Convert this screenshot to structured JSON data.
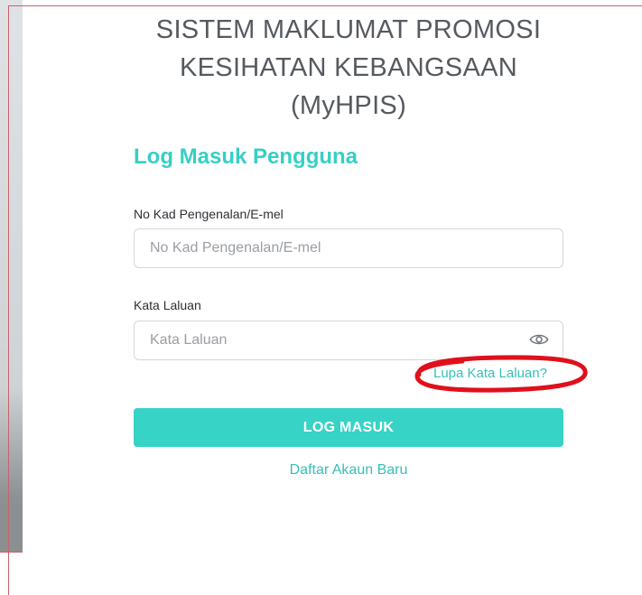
{
  "header": {
    "title_line1": "SISTEM MAKLUMAT PROMOSI",
    "title_line2": "KESIHATAN KEBANGSAAN",
    "title_line3": "(MyHPIS)"
  },
  "login": {
    "heading": "Log Masuk Pengguna",
    "id_label": "No Kad Pengenalan/E-mel",
    "id_placeholder": "No Kad Pengenalan/E-mel",
    "password_label": "Kata Laluan",
    "password_placeholder": "Kata Laluan",
    "password_toggle_icon": "eye-icon",
    "forgot_password": "Lupa Kata Laluan?",
    "submit_label": "LOG MASUK",
    "register_link": "Daftar Akaun Baru"
  },
  "colors": {
    "accent": "#36d3c6",
    "link": "#36bfb6",
    "title": "#555a5f",
    "annotation": "#e0101c"
  }
}
